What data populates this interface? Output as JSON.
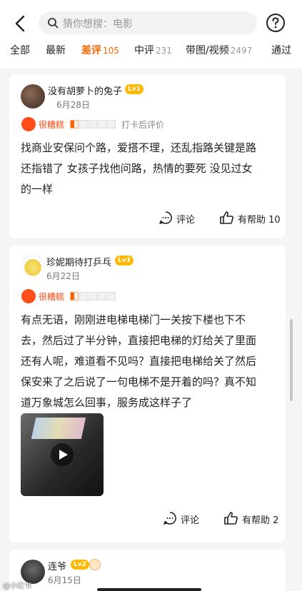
{
  "header": {
    "search_placeholder": "猜你想搜：电影",
    "icons": {
      "back": "back-arrow-icon",
      "search": "search-icon",
      "help": "help-icon"
    }
  },
  "tabs": [
    {
      "label": "全部",
      "count": ""
    },
    {
      "label": "最新",
      "count": ""
    },
    {
      "label": "差评",
      "count": "105",
      "active": true
    },
    {
      "label": "中评",
      "count": "231"
    },
    {
      "label": "带图/视频",
      "count": "2497"
    },
    {
      "label": "通过",
      "count": ""
    }
  ],
  "reviews": [
    {
      "username": "没有胡萝卜的兔子",
      "level": "Lv1",
      "date": "6月28日",
      "rating_label": "很糟糕",
      "stars": 0.5,
      "rating_extra": "打卡后评价",
      "lines": [
        "找商业安保问个路，爱搭不理，还乱指路关键是路",
        "还指错了 女孩子找他问路，热情的要死  没见过女",
        "的一样"
      ],
      "comment_label": "评论",
      "helpful_label": "有帮助 10"
    },
    {
      "username": "珍妮期待打乒乓",
      "level": "Lv3",
      "date": "6月22日",
      "rating_label": "很糟糕",
      "stars": 0.5,
      "lines": [
        "有点无语，刚刚进电梯电梯门一关按下楼也下不",
        "去，然后过了半分钟，直接把电梯的灯给关了里面",
        "还有人呢，难道看不见吗？直接把电梯给关了然后",
        "保安来了之后说了一句电梯不是开着的吗？真不知",
        "道万象城怎么回事，服务成这样子了"
      ],
      "comment_label": "评论",
      "helpful_label": "有帮助 2"
    },
    {
      "username": "连爷",
      "level": "Lv2",
      "date": "6月15日"
    }
  ],
  "watermark": "@小红书"
}
